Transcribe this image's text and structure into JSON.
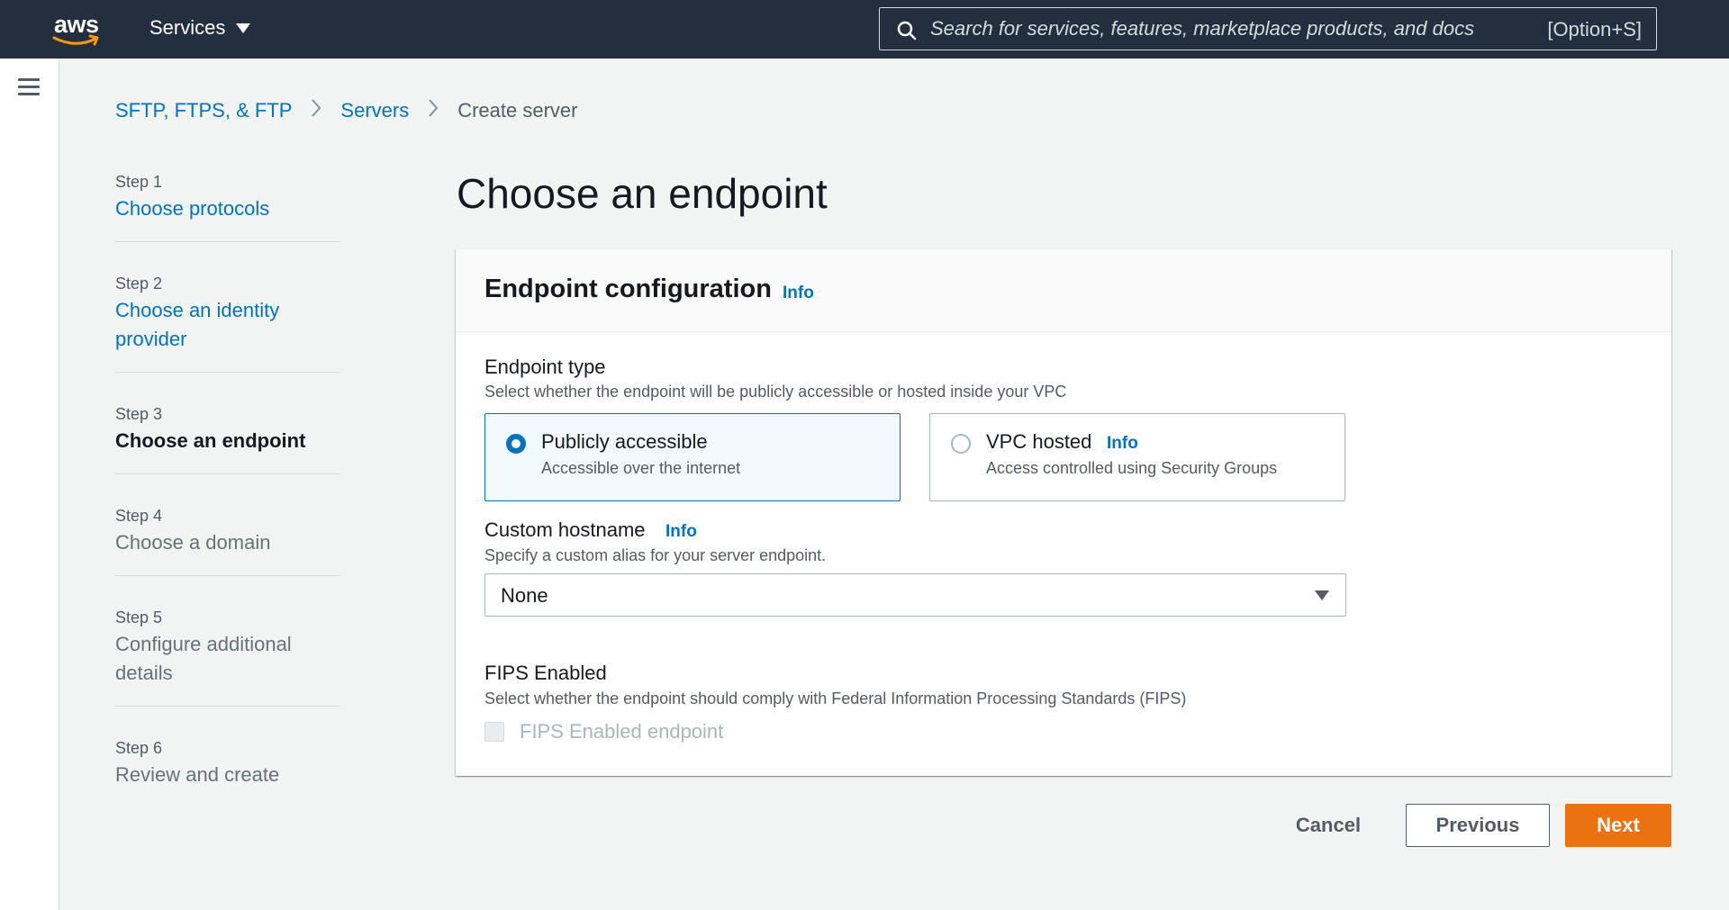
{
  "nav": {
    "logo_text": "aws",
    "services_label": "Services",
    "search_placeholder": "Search for services, features, marketplace products, and docs",
    "search_value": "",
    "search_shortcut": "[Option+S]"
  },
  "breadcrumb": {
    "items": [
      "SFTP, FTPS, & FTP",
      "Servers"
    ],
    "current": "Create server"
  },
  "steps": [
    {
      "number": "Step 1",
      "label": "Choose protocols",
      "state": "link"
    },
    {
      "number": "Step 2",
      "label": "Choose an identity provider",
      "state": "link"
    },
    {
      "number": "Step 3",
      "label": "Choose an endpoint",
      "state": "active"
    },
    {
      "number": "Step 4",
      "label": "Choose a domain",
      "state": "disabled"
    },
    {
      "number": "Step 5",
      "label": "Configure additional details",
      "state": "disabled"
    },
    {
      "number": "Step 6",
      "label": "Review and create",
      "state": "disabled"
    }
  ],
  "page": {
    "title": "Choose an endpoint"
  },
  "panel": {
    "title": "Endpoint configuration",
    "info": "Info",
    "endpoint_type": {
      "label": "Endpoint type",
      "description": "Select whether the endpoint will be publicly accessible or hosted inside your VPC",
      "options": [
        {
          "title": "Publicly accessible",
          "description": "Accessible over the internet",
          "selected": true
        },
        {
          "title": "VPC hosted",
          "info": "Info",
          "description": "Access controlled using Security Groups",
          "selected": false
        }
      ]
    },
    "custom_hostname": {
      "label": "Custom hostname",
      "info": "Info",
      "description": "Specify a custom alias for your server endpoint.",
      "selected_value": "None"
    },
    "fips": {
      "label": "FIPS Enabled",
      "description": "Select whether the endpoint should comply with Federal Information Processing Standards (FIPS)",
      "checkbox_label": "FIPS Enabled endpoint",
      "checked": false,
      "disabled": true
    }
  },
  "footer": {
    "cancel_label": "Cancel",
    "previous_label": "Previous",
    "next_label": "Next"
  },
  "colors": {
    "nav_bg": "#232f3e",
    "link": "#0073bb",
    "primary_button": "#ec7211",
    "page_bg": "#f2f3f3"
  }
}
